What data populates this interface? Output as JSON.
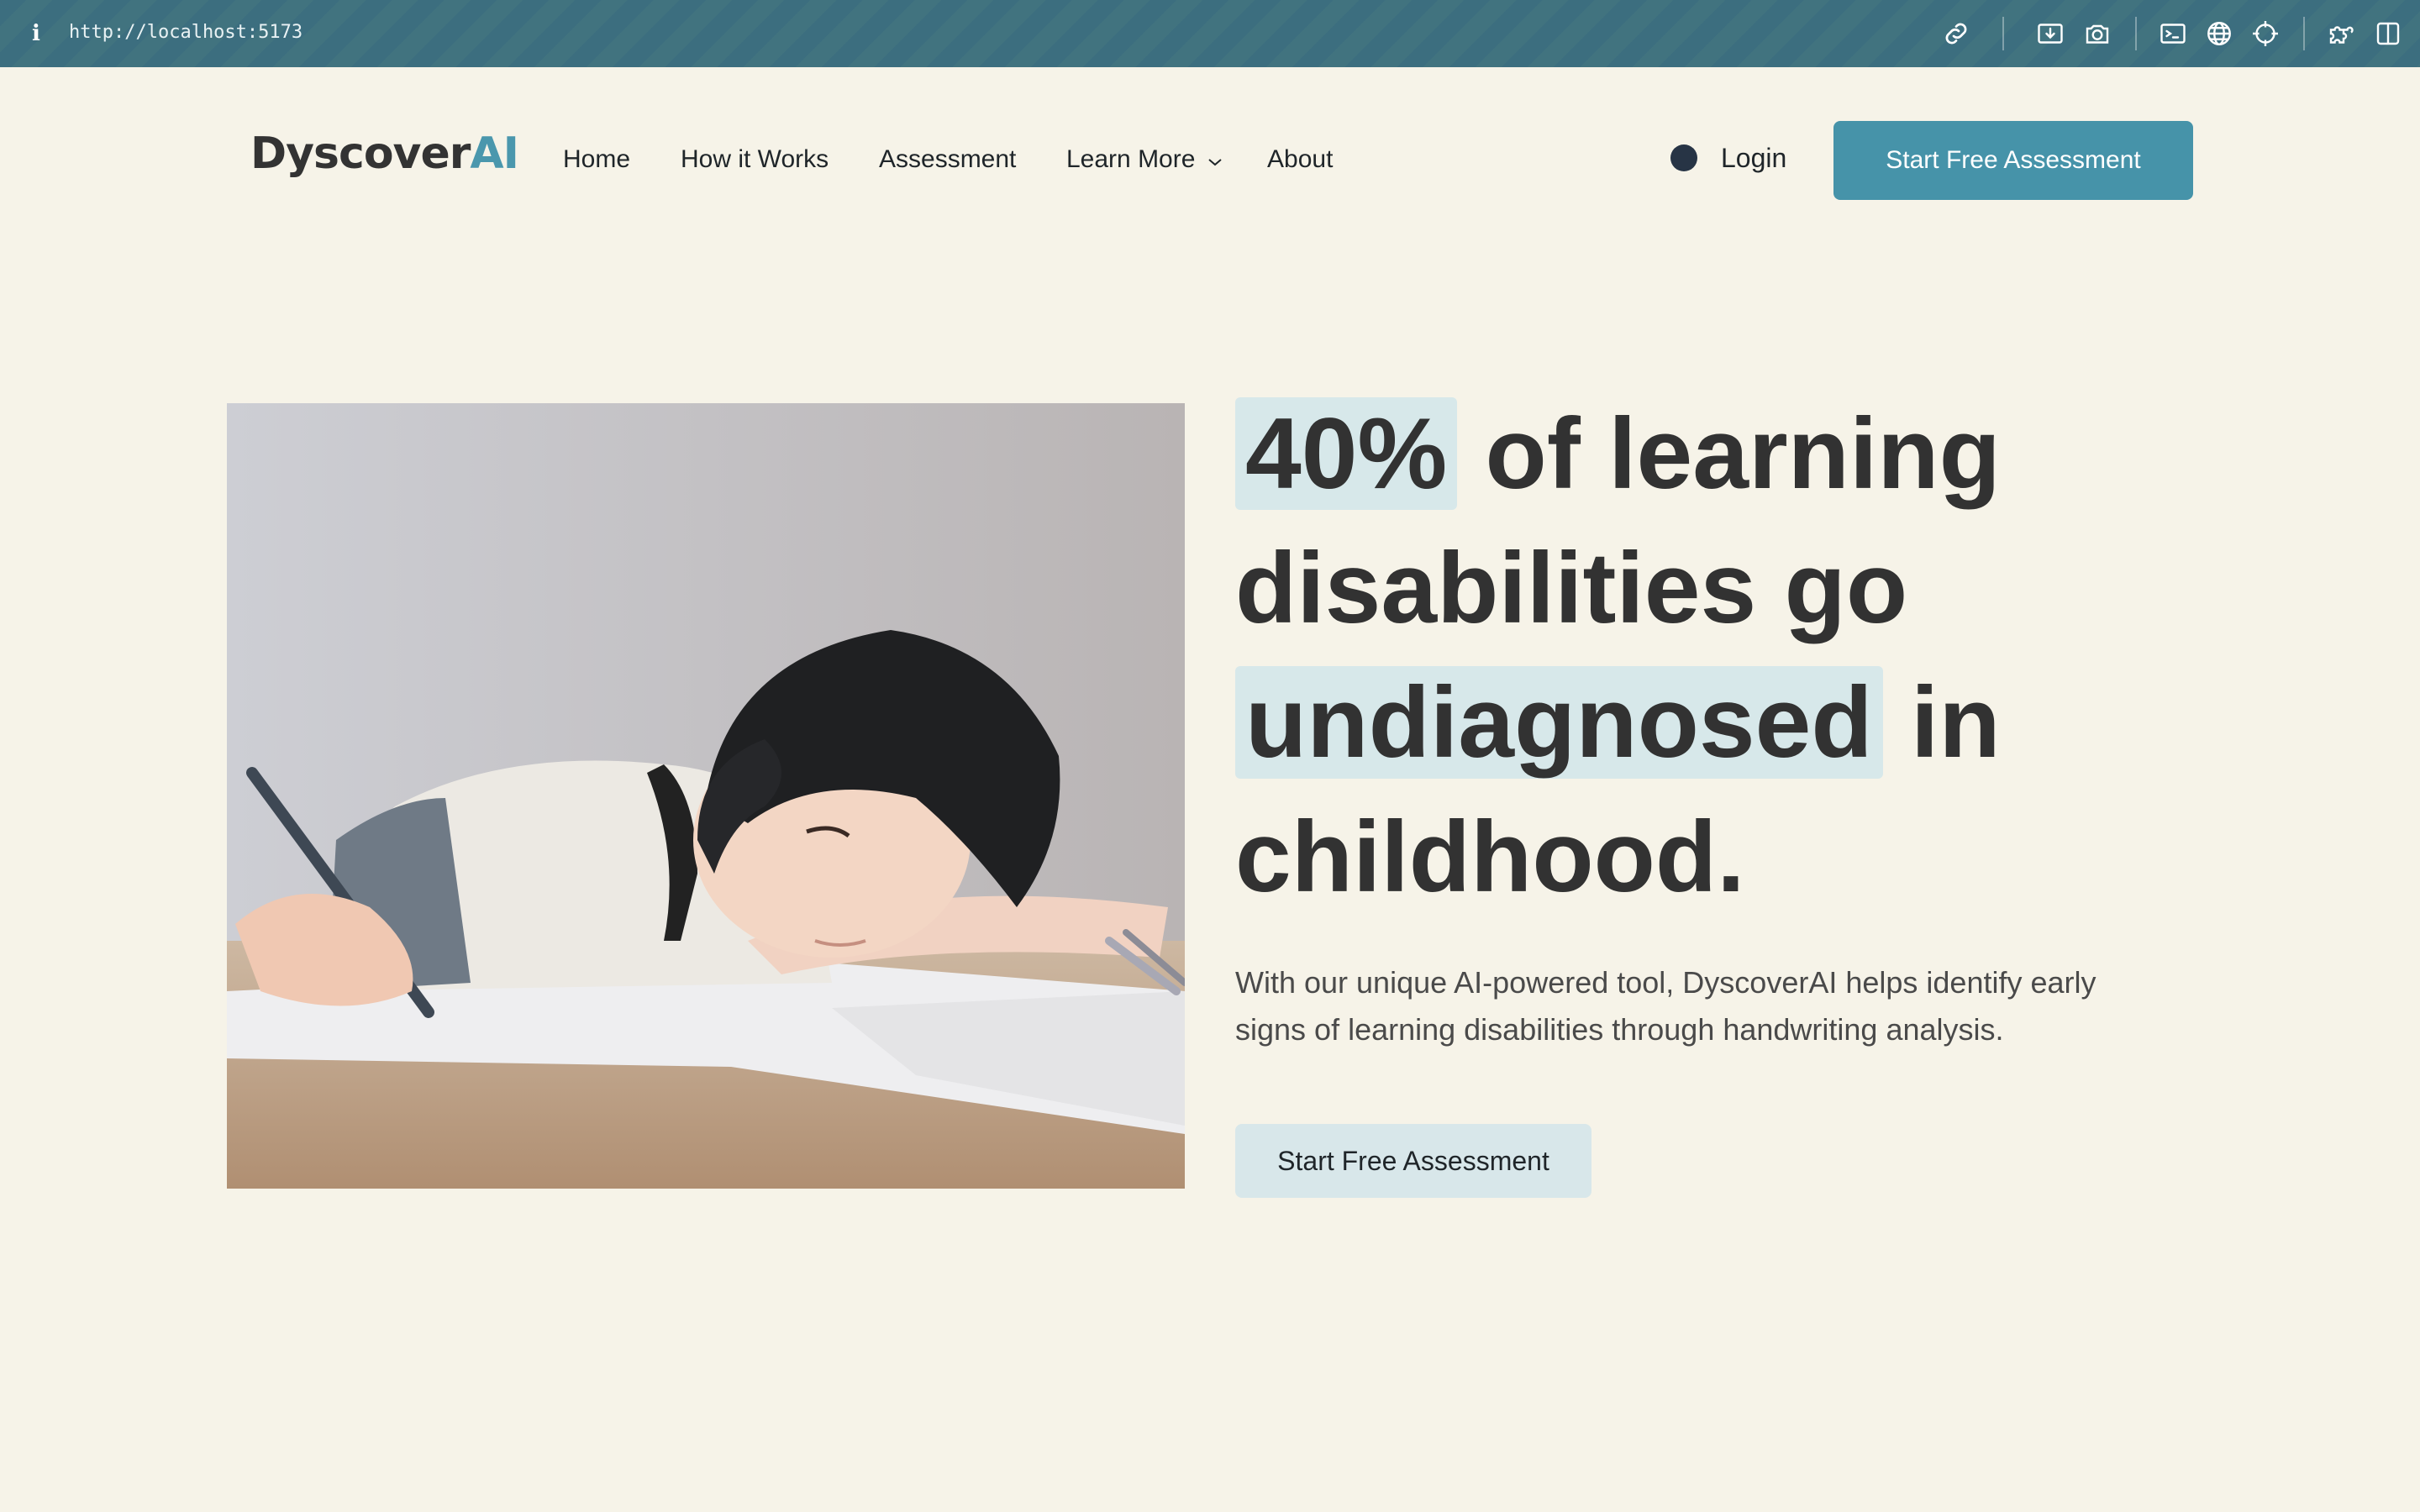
{
  "browser": {
    "url": "http://localhost:5173",
    "toolbar_icons": [
      "link-icon",
      "download-icon",
      "camera-icon",
      "terminal-icon",
      "globe-icon",
      "crosshair-icon",
      "extensions-icon",
      "sidebar-icon"
    ]
  },
  "header": {
    "logo_main": "Dyscover",
    "logo_accent": "AI",
    "nav": [
      {
        "label": "Home"
      },
      {
        "label": "How it Works"
      },
      {
        "label": "Assessment"
      },
      {
        "label": "Learn More"
      },
      {
        "label": "About"
      }
    ],
    "login_label": "Login",
    "cta_label": "Start Free Assessment"
  },
  "hero": {
    "headline": {
      "stat": "40%",
      "part1": " of learning",
      "line2": "disabilities go",
      "highlight2": "undiagnosed",
      "part3": " in",
      "line4": "childhood."
    },
    "subtext": "With our unique AI-powered tool, DyscoverAI helps identify early signs of learning disabilities through handwriting analysis.",
    "cta_label": "Start Free Assessment"
  },
  "colors": {
    "page_bg": "#f6f3e8",
    "accent": "#4693a9",
    "highlight_bg": "#d7e8ea",
    "toolbar_bg": "#3c6e7f"
  }
}
